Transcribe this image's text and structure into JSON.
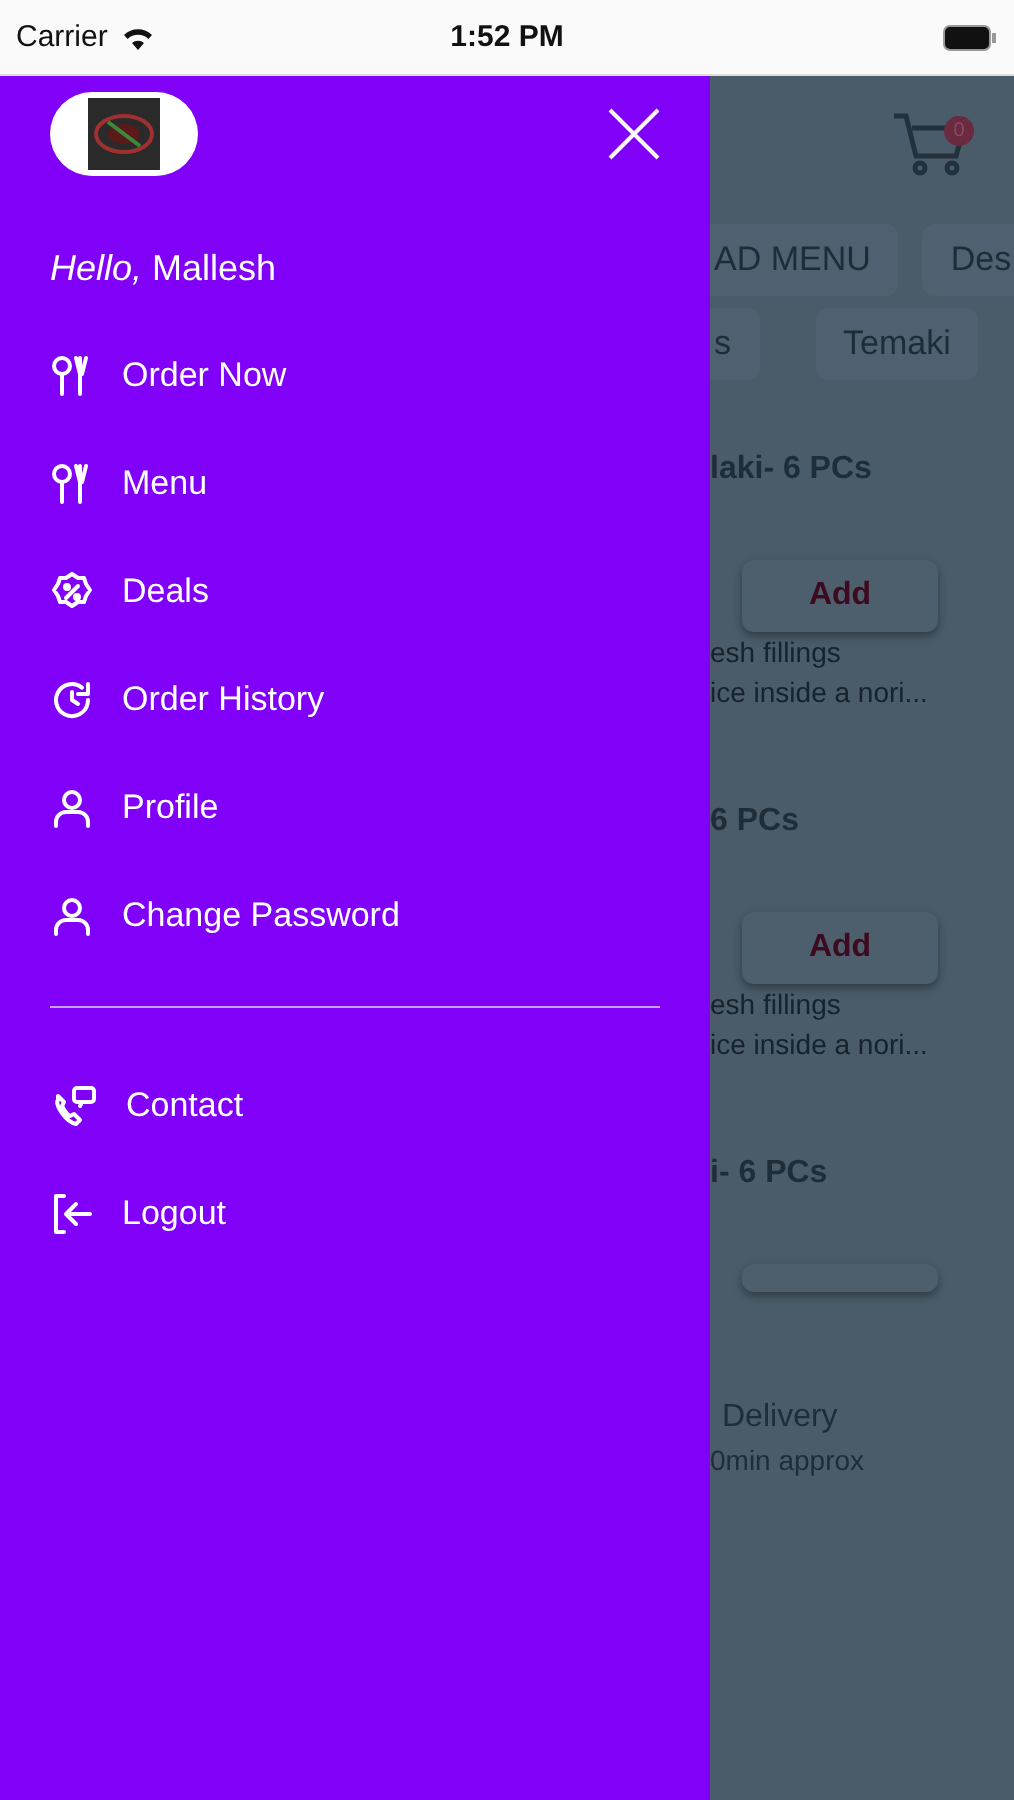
{
  "status_bar": {
    "carrier": "Carrier",
    "time": "1:52 PM"
  },
  "drawer": {
    "greeting": "*Hello,* Mallesh",
    "items": [
      {
        "label": "Order Now",
        "kind": "utensils"
      },
      {
        "label": "Menu",
        "kind": "utensils"
      },
      {
        "label": "Deals",
        "kind": "deal"
      },
      {
        "label": "Order History",
        "kind": "history"
      },
      {
        "label": "Profile",
        "kind": "user"
      },
      {
        "label": "Change Password",
        "kind": "user"
      }
    ],
    "footer_items": [
      {
        "label": "Contact",
        "kind": "contact"
      },
      {
        "label": "Logout",
        "kind": "logout"
      }
    ]
  },
  "background": {
    "cart_count": "0",
    "category_rows": [
      [
        "AD MENU",
        "Des"
      ],
      [
        "s",
        "Temaki"
      ]
    ],
    "products": [
      {
        "title": "laki- 6 PCs",
        "button": "Add",
        "lines": [
          "esh fillings",
          "ice inside a nori..."
        ]
      },
      {
        "title": "6 PCs",
        "button": "Add",
        "lines": [
          "esh fillings",
          "ice inside a nori..."
        ]
      },
      {
        "title": "i- 6 PCs"
      }
    ],
    "delivery": {
      "title": "Delivery",
      "subtitle": "0min approx"
    }
  }
}
